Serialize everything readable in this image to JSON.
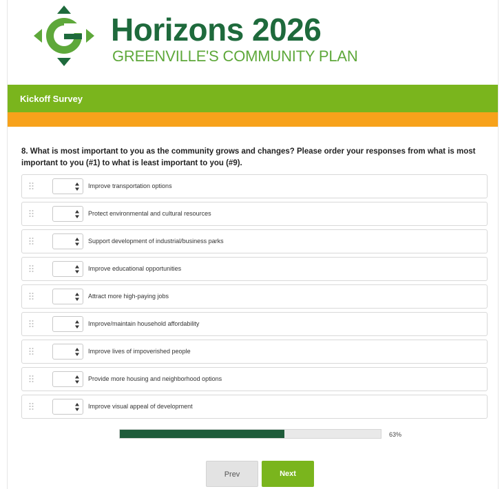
{
  "header": {
    "title": "Horizons 2026",
    "subtitle": "GREENVILLE'S COMMUNITY PLAN"
  },
  "survey": {
    "section_title": "Kickoff Survey",
    "question": "8. What is most important to you as the community grows and changes? Please order your responses from what is most important to you (#1) to what is least important to you (#9).",
    "items": [
      {
        "label": "Improve transportation options"
      },
      {
        "label": "Protect environmental and cultural resources"
      },
      {
        "label": "Support development of industrial/business parks"
      },
      {
        "label": "Improve educational opportunities"
      },
      {
        "label": "Attract more high-paying jobs"
      },
      {
        "label": "Improve/maintain household affordability"
      },
      {
        "label": "Improve lives of impoverished people"
      },
      {
        "label": "Provide more housing and neighborhood options"
      },
      {
        "label": "Improve visual appeal of development"
      }
    ]
  },
  "progress": {
    "percent": 63,
    "label": "63%"
  },
  "navigation": {
    "prev_label": "Prev",
    "next_label": "Next"
  },
  "colors": {
    "brand_dark_green": "#1e6a3c",
    "brand_light_green": "#7ab51d",
    "accent_orange": "#f7a21b",
    "progress_fill": "#1e5c3a"
  },
  "icons": {
    "logo": "horizons-g-compass-logo",
    "drag": "drag-handle-icon",
    "select_arrows": "sort-arrows-icon"
  }
}
